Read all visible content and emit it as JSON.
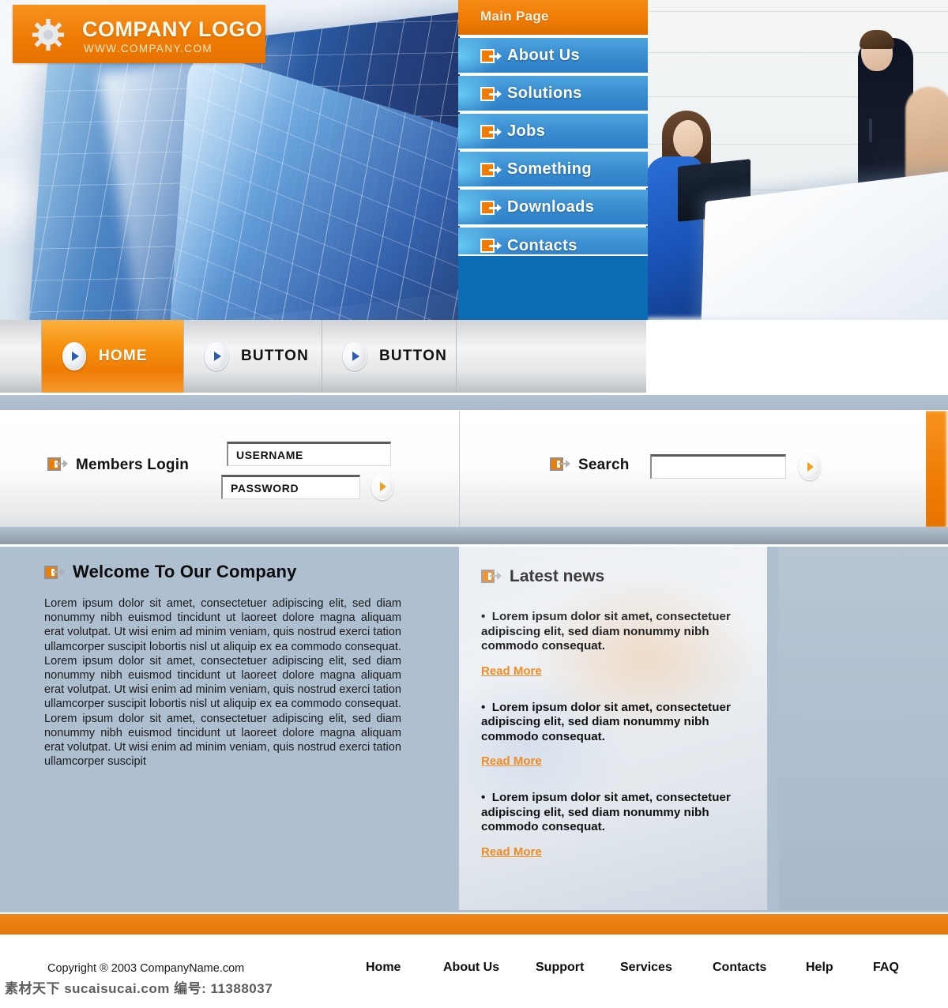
{
  "brand": {
    "logo_icon": "gear-icon",
    "name": "COMPANY LOGO",
    "url": "WWW.COMPANY.COM"
  },
  "vertical_nav": {
    "header_label": "Main Page",
    "items": [
      {
        "label": "About Us",
        "icon": "exit-arrow-icon"
      },
      {
        "label": "Solutions",
        "icon": "exit-arrow-icon"
      },
      {
        "label": "Jobs",
        "icon": "exit-arrow-icon"
      },
      {
        "label": "Something",
        "icon": "exit-arrow-icon"
      },
      {
        "label": "Downloads",
        "icon": "exit-arrow-icon"
      },
      {
        "label": "Contacts",
        "icon": "exit-arrow-icon"
      }
    ]
  },
  "button_bar": {
    "tabs": [
      {
        "label": "HOME",
        "active": true,
        "icon": "play-triangle-icon"
      },
      {
        "label": "BUTTON",
        "active": false,
        "icon": "play-triangle-icon"
      },
      {
        "label": "BUTTON",
        "active": false,
        "icon": "play-triangle-icon"
      }
    ]
  },
  "login": {
    "label": "Members Login",
    "icon": "exit-arrow-icon",
    "username_value": "USERNAME",
    "username_placeholder": "USERNAME",
    "password_value": "PASSWORD",
    "password_placeholder": "PASSWORD",
    "submit_icon": "play-triangle-icon"
  },
  "search": {
    "label": "Search",
    "icon": "exit-arrow-icon",
    "value": "",
    "placeholder": "",
    "submit_icon": "play-triangle-icon"
  },
  "welcome": {
    "icon": "exit-arrow-icon",
    "title": "Welcome To Our Company",
    "body": "Lorem ipsum dolor sit amet, consectetuer adipiscing elit, sed diam nonummy nibh euismod tincidunt ut laoreet dolore magna aliquam erat volutpat. Ut wisi enim ad minim veniam, quis nostrud exerci tation ullamcorper suscipit lobortis nisl ut aliquip ex ea commodo consequat. Lorem ipsum dolor sit amet, consectetuer adipiscing elit, sed diam nonummy nibh euismod tincidunt ut laoreet dolore magna aliquam erat volutpat. Ut wisi enim ad minim veniam, quis nostrud exerci tation ullamcorper suscipit lobortis nisl ut aliquip ex ea commodo consequat. Lorem ipsum dolor sit amet, consectetuer adipiscing elit, sed diam nonummy nibh euismod tincidunt ut laoreet dolore magna aliquam erat volutpat. Ut wisi enim ad minim veniam, quis nostrud exerci tation ullamcorper suscipit"
  },
  "news": {
    "icon": "exit-arrow-icon",
    "title": "Latest news",
    "read_more_label": "Read More",
    "items": [
      {
        "bullet": "•",
        "text": "Lorem ipsum dolor sit amet, consectetuer adipiscing elit, sed diam nonummy nibh commodo consequat.",
        "link": "Read More"
      },
      {
        "bullet": "•",
        "text": "Lorem ipsum dolor sit amet, consectetuer adipiscing elit, sed diam nonummy nibh commodo consequat.",
        "link": "Read More"
      },
      {
        "bullet": "•",
        "text": "Lorem ipsum dolor sit amet, consectetuer adipiscing elit, sed diam nonummy nibh commodo consequat.",
        "link": "Read More"
      }
    ]
  },
  "footer": {
    "copyright": "Copyright ® 2003 CompanyName.com",
    "links": [
      "Home",
      "About Us",
      "Support",
      "Services",
      "Contacts",
      "Help",
      "FAQ"
    ],
    "watermark": "素材天下 sucaisucai.com 编号: 11388037"
  },
  "colors": {
    "orange": "#ef7c05",
    "orange_light": "#f7931e",
    "blue_nav": "#3b8fd2",
    "blue_dark": "#0c6cb4",
    "content_bg": "#aebfd0",
    "link_orange": "#ef8b22"
  }
}
